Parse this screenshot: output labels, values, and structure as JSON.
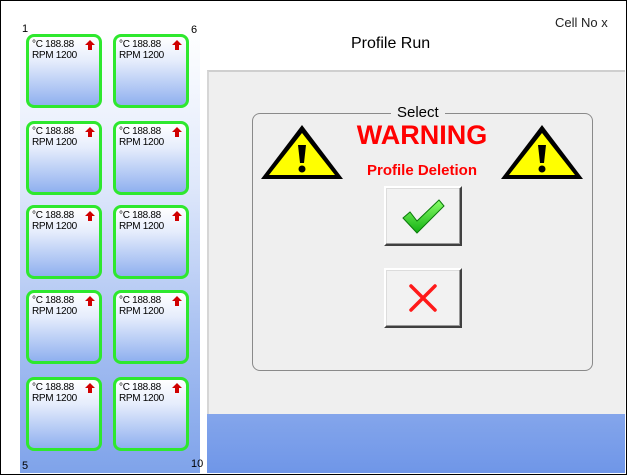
{
  "window": {
    "title": "Profile Run",
    "cell_no_label": "Cell No  x"
  },
  "cells": {
    "corner_numbers": {
      "top_left": "1",
      "top_right": "6",
      "bottom_left": "5",
      "bottom_right": "10"
    },
    "items": [
      {
        "temp": "°C 188.88",
        "rpm": "RPM 1200"
      },
      {
        "temp": "°C 188.88",
        "rpm": "RPM 1200"
      },
      {
        "temp": "°C 188.88",
        "rpm": "RPM 1200"
      },
      {
        "temp": "°C 188.88",
        "rpm": "RPM 1200"
      },
      {
        "temp": "°C 188.88",
        "rpm": "RPM 1200"
      },
      {
        "temp": "°C 188.88",
        "rpm": "RPM 1200"
      },
      {
        "temp": "°C 188.88",
        "rpm": "RPM 1200"
      },
      {
        "temp": "°C 188.88",
        "rpm": "RPM 1200"
      },
      {
        "temp": "°C 188.88",
        "rpm": "RPM 1200"
      },
      {
        "temp": "°C 188.88",
        "rpm": "RPM 1200"
      }
    ],
    "status_icon": "red-up-arrow-icon",
    "border_color": "#2ee82e"
  },
  "dialog": {
    "group_label": "Select",
    "warning_title": "WARNING",
    "warning_subtitle": "Profile Deletion",
    "warning_color": "#ff0000",
    "confirm_icon": "checkmark-icon",
    "cancel_icon": "cross-icon"
  }
}
